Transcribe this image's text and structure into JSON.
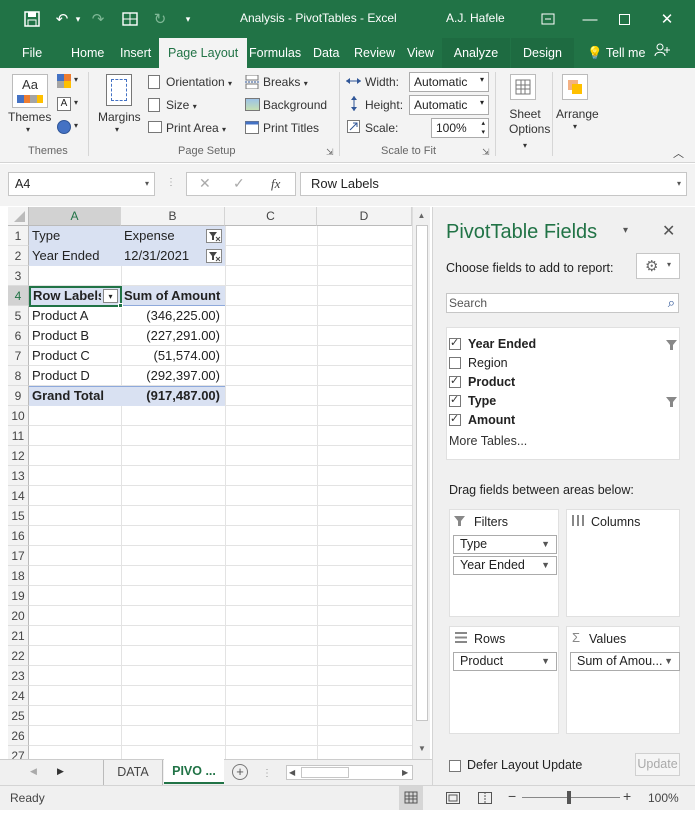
{
  "window": {
    "title": "Analysis - PivotTables  -  Excel",
    "user": "A.J. Hafele"
  },
  "tabs": [
    "File",
    "Home",
    "Insert",
    "Page Layout",
    "Formulas",
    "Data",
    "Review",
    "View",
    "Analyze",
    "Design"
  ],
  "tell_me": "Tell me",
  "ribbon": {
    "themes": {
      "label": "Themes",
      "group": "Themes"
    },
    "page_setup": {
      "margins": "Margins",
      "orientation": "Orientation",
      "size": "Size",
      "print_area": "Print Area",
      "breaks": "Breaks",
      "background": "Background",
      "print_titles": "Print Titles",
      "group": "Page Setup"
    },
    "scale_to_fit": {
      "width_label": "Width:",
      "width_value": "Automatic",
      "height_label": "Height:",
      "height_value": "Automatic",
      "scale_label": "Scale:",
      "scale_value": "100%",
      "group": "Scale to Fit"
    },
    "sheet_options": {
      "label": "Sheet Options"
    },
    "arrange": {
      "label": "Arrange"
    }
  },
  "formula_bar": {
    "name_box": "A4",
    "content": "Row Labels"
  },
  "columns": [
    "A",
    "B",
    "C",
    "D"
  ],
  "rows": [
    "1",
    "2",
    "3",
    "4",
    "5",
    "6",
    "7",
    "8",
    "9",
    "10",
    "11",
    "12",
    "13",
    "14",
    "15",
    "16",
    "17",
    "18",
    "19",
    "20",
    "21",
    "22",
    "23",
    "24",
    "25",
    "26",
    "27"
  ],
  "cells": {
    "a1": "Type",
    "b1": "Expense",
    "a2": "Year Ended",
    "b2": "12/31/2021",
    "a4": "Row Labels",
    "b4": "Sum of Amount",
    "a5": "Product A",
    "b5": "(346,225.00)",
    "a6": "Product B",
    "b6": "(227,291.00)",
    "a7": "Product C",
    "b7": "(51,574.00)",
    "a8": "Product D",
    "b8": "(292,397.00)",
    "a9": "Grand Total",
    "b9": "(917,487.00)"
  },
  "sheet_tabs": [
    "DATA",
    "PIVO ..."
  ],
  "status": {
    "ready": "Ready",
    "zoom": "100%"
  },
  "pivot": {
    "title": "PivotTable Fields",
    "choose": "Choose fields to add to report:",
    "search_placeholder": "Search",
    "fields": [
      {
        "name": "Year Ended",
        "checked": true,
        "filter": true
      },
      {
        "name": "Region",
        "checked": false,
        "filter": false
      },
      {
        "name": "Product",
        "checked": true,
        "filter": false
      },
      {
        "name": "Type",
        "checked": true,
        "filter": true
      },
      {
        "name": "Amount",
        "checked": true,
        "filter": false
      }
    ],
    "more_tables": "More Tables...",
    "drag": "Drag fields between areas below:",
    "areas": {
      "filters": "Filters",
      "columns": "Columns",
      "rows": "Rows",
      "values": "Values"
    },
    "filter_chips": [
      "Type",
      "Year Ended"
    ],
    "row_chips": [
      "Product"
    ],
    "value_chips": [
      "Sum of Amou..."
    ],
    "defer": "Defer Layout Update",
    "update": "Update"
  },
  "colors": {
    "excel_green": "#217346",
    "header_fill": "#d9e1f2"
  }
}
